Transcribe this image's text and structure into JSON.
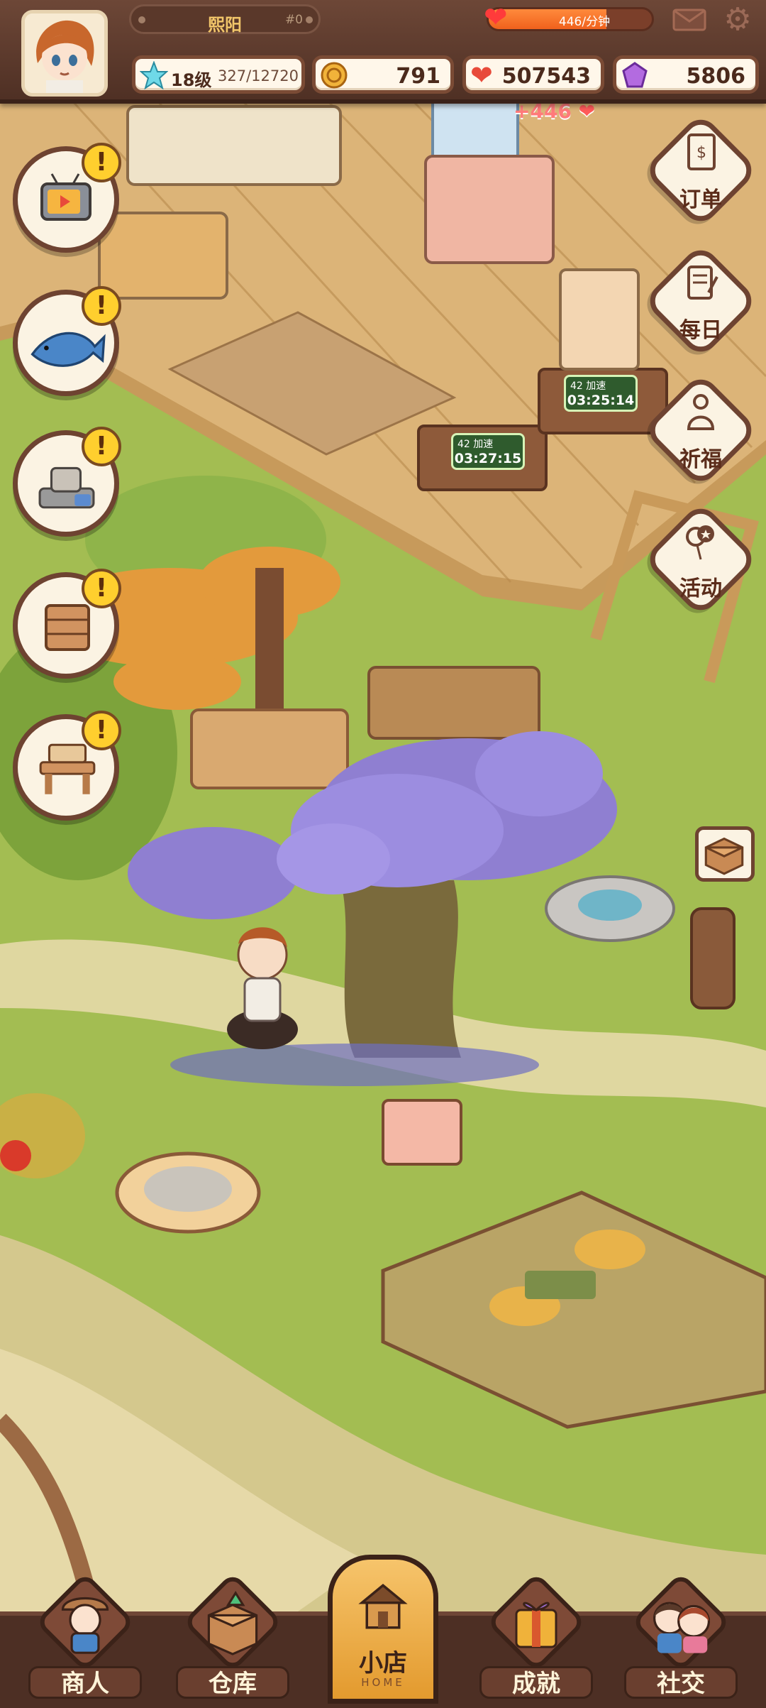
{
  "player": {
    "name": "熙阳",
    "rank": "#0",
    "level": "18级",
    "exp": "327/12720"
  },
  "hearts_rate": {
    "label": "446/分钟",
    "fill_fraction": 0.72
  },
  "currencies": {
    "coins": "791",
    "hearts": "507543",
    "gems": "5806"
  },
  "floating_gain": "+446",
  "left_buttons": [
    {
      "name": "tv-ads",
      "alert": "!"
    },
    {
      "name": "fishing",
      "alert": "!"
    },
    {
      "name": "cooking",
      "alert": "!"
    },
    {
      "name": "cabinet",
      "alert": "!"
    },
    {
      "name": "workbench",
      "alert": "!"
    }
  ],
  "right_buttons": [
    {
      "label": "订单"
    },
    {
      "label": "每日"
    },
    {
      "label": "祈福"
    },
    {
      "label": "活动"
    }
  ],
  "timers": [
    {
      "boost": "42 加速",
      "time": "03:25:14"
    },
    {
      "boost": "42 加速",
      "time": "03:27:15"
    }
  ],
  "nav": {
    "merchant": "商人",
    "warehouse": "仓库",
    "shop": "小店",
    "shop_sub": "HOME",
    "achievement": "成就",
    "social": "社交"
  },
  "colors": {
    "accent": "#f2c66a",
    "panel": "#6d4737",
    "grass": "#9bb64a"
  }
}
